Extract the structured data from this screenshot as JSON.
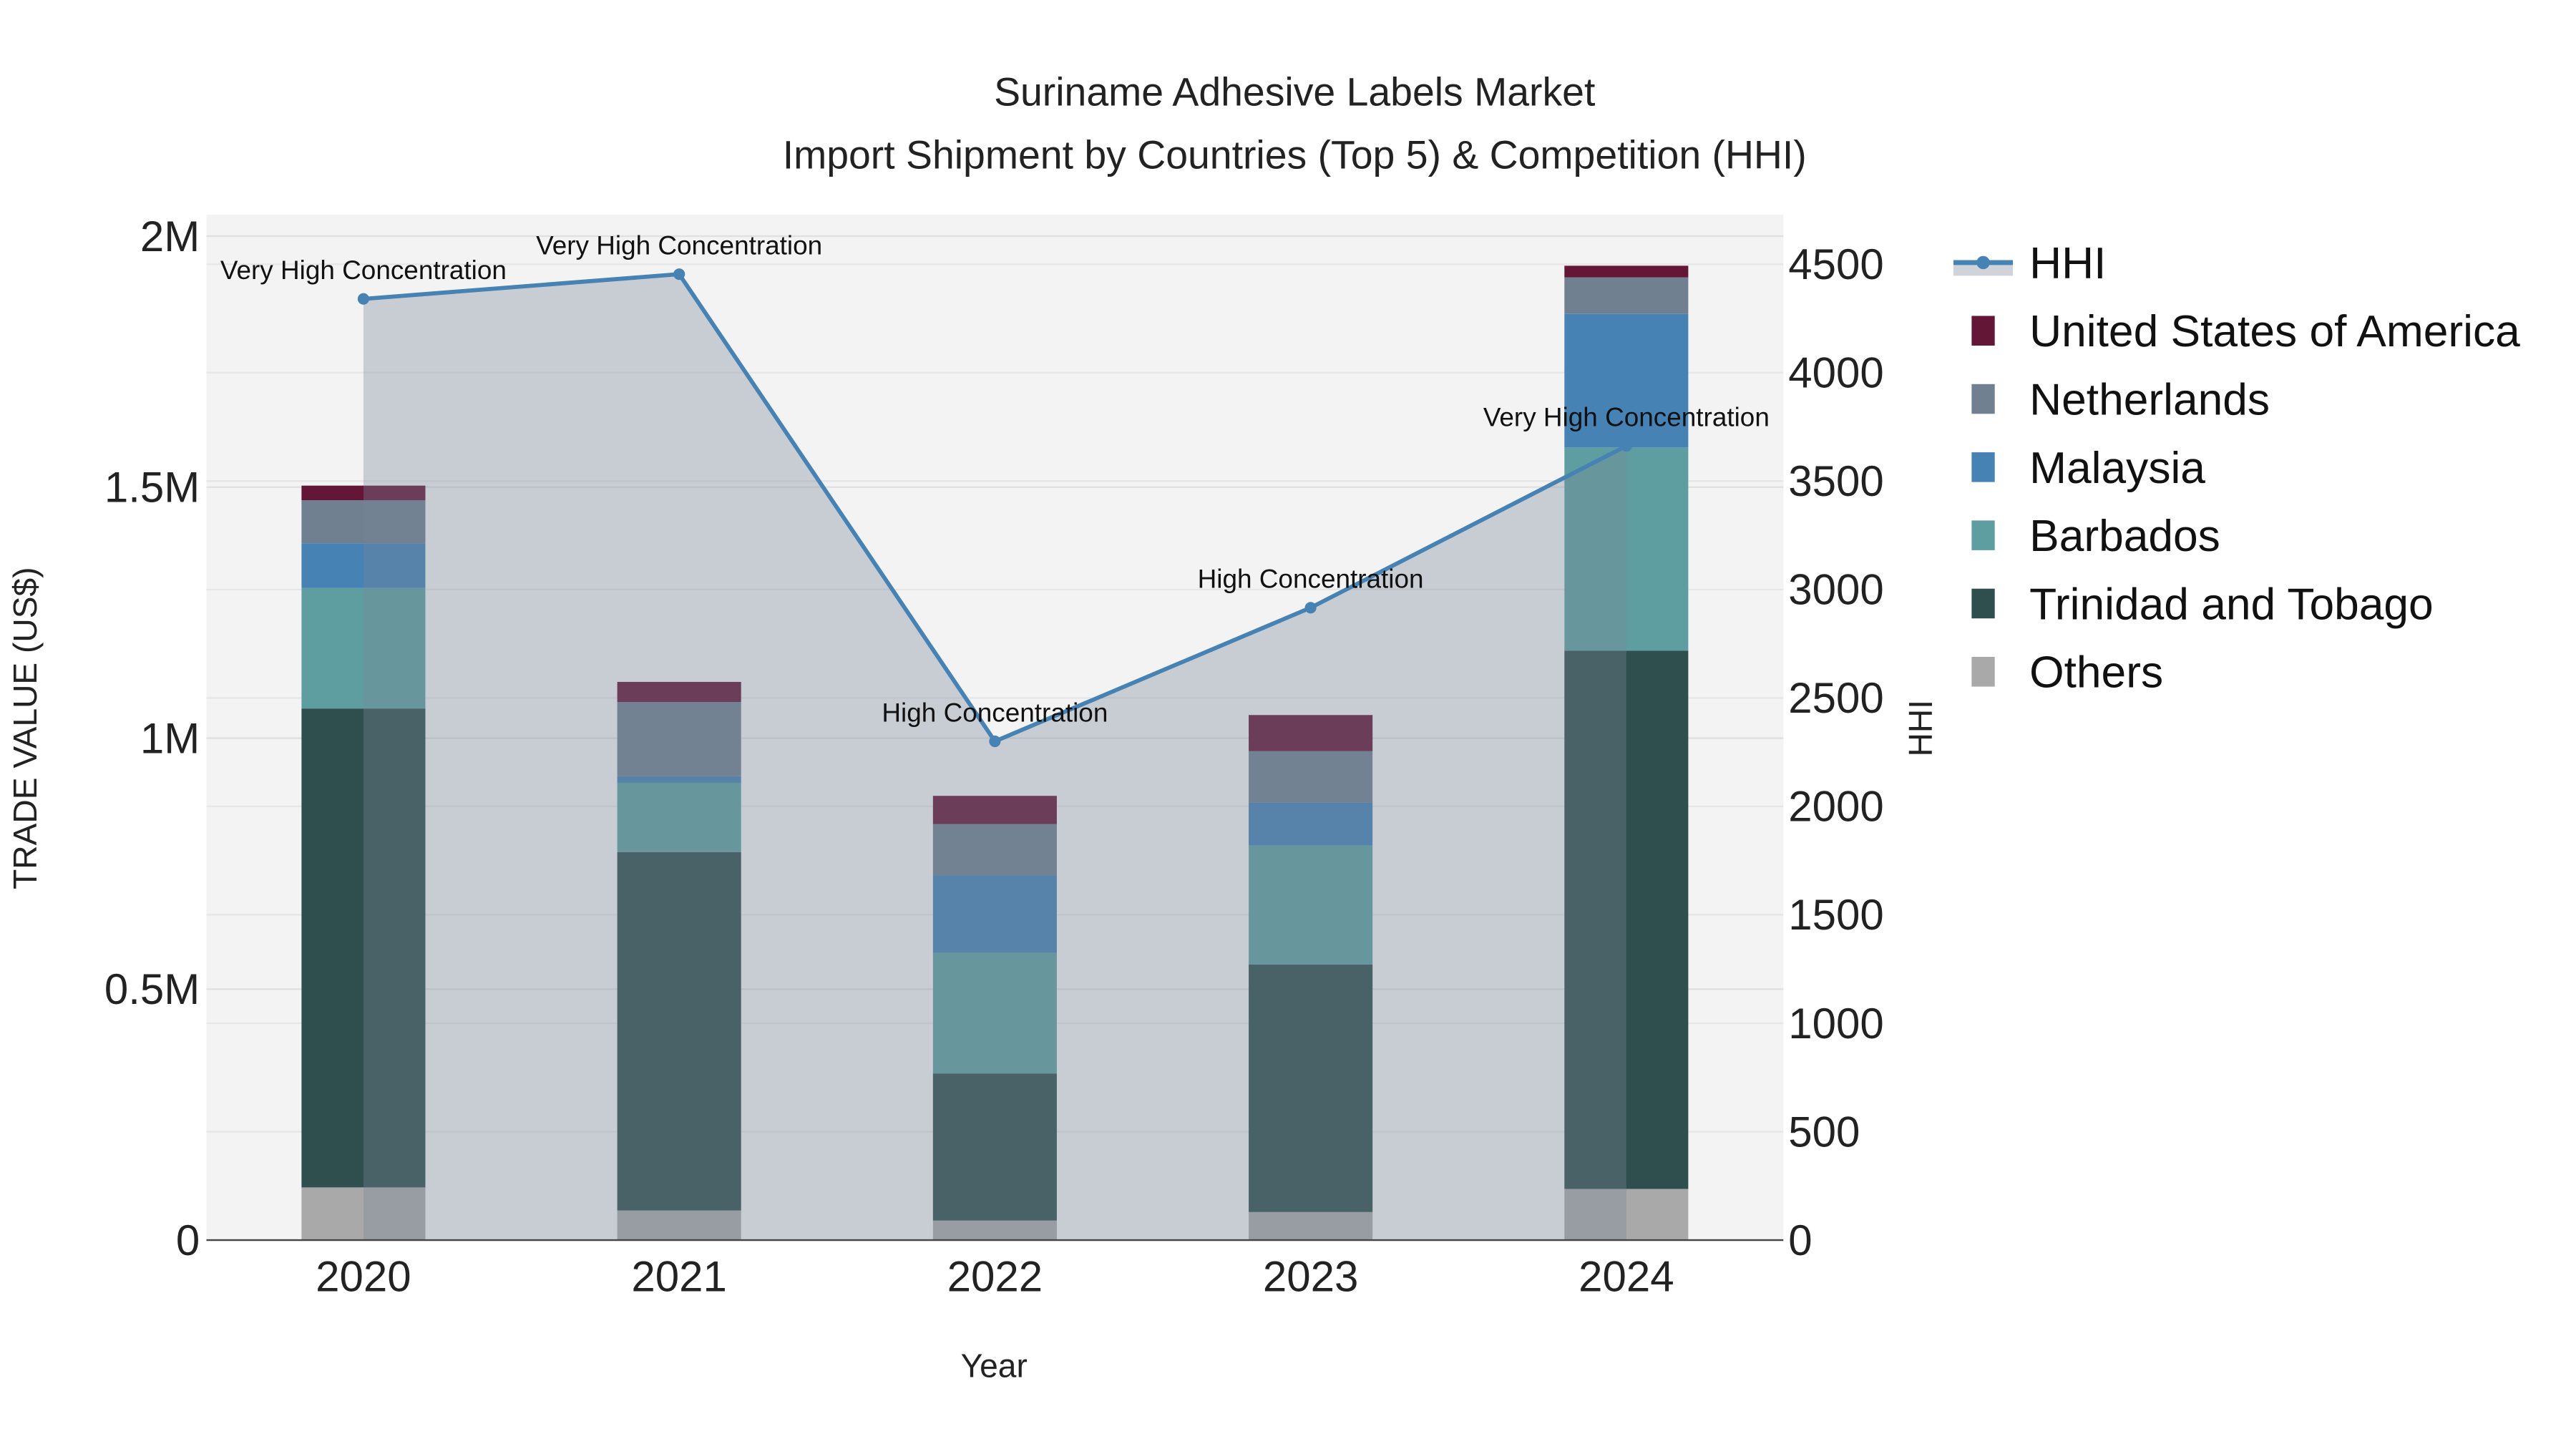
{
  "chart_data": {
    "type": "bar",
    "stacked": true,
    "title": "Suriname Adhesive Labels Market",
    "subtitle": "Import Shipment by Countries (Top 5) & Competition (HHI)",
    "xlabel": "Year",
    "ylabel": "TRADE VALUE (US$)",
    "y2label": "HHI",
    "categories": [
      "2020",
      "2021",
      "2022",
      "2023",
      "2024"
    ],
    "ylim": [
      0,
      2000000
    ],
    "y_ticks": [
      0,
      500000,
      1000000,
      1500000,
      2000000
    ],
    "y_tick_labels": [
      "0",
      "0.5M",
      "1M",
      "1.5M",
      "2M"
    ],
    "y2lim": [
      0,
      4750
    ],
    "y2_ticks": [
      0,
      500,
      1000,
      1500,
      2000,
      2500,
      3000,
      3500,
      4000,
      4500
    ],
    "y2_tick_labels": [
      "0",
      "500",
      "1000",
      "1500",
      "2000",
      "2500",
      "3000",
      "3500",
      "4000",
      "4500"
    ],
    "grid": true,
    "legend_position": "right",
    "series": [
      {
        "name": "Others",
        "color": "#A9A9A9",
        "values": [
          105000,
          59000,
          39000,
          56000,
          102000
        ]
      },
      {
        "name": "Trinidad and Tobago",
        "color": "#2F4F4F",
        "values": [
          954000,
          714000,
          293000,
          493000,
          1072000
        ]
      },
      {
        "name": "Barbados",
        "color": "#5F9EA0",
        "values": [
          240000,
          138000,
          240000,
          237000,
          405000
        ]
      },
      {
        "name": "Malaysia",
        "color": "#4682B4",
        "values": [
          89000,
          13000,
          155000,
          86000,
          266000
        ]
      },
      {
        "name": "Netherlands",
        "color": "#708090",
        "values": [
          86000,
          148000,
          102000,
          102000,
          73000
        ]
      },
      {
        "name": "United States of America",
        "color": "#641637",
        "values": [
          29000,
          40000,
          56000,
          72000,
          23000
        ]
      }
    ],
    "hhi": {
      "name": "HHI",
      "color": "#4682B4",
      "values": [
        4340,
        4454,
        2300,
        2916,
        3662
      ],
      "annotations": [
        "Very High Concentration",
        "Very High Concentration",
        "High Concentration",
        "High Concentration",
        "Very High Concentration"
      ]
    },
    "legend_order": [
      "HHI",
      "United States of America",
      "Netherlands",
      "Malaysia",
      "Barbados",
      "Trinidad and Tobago",
      "Others"
    ]
  }
}
